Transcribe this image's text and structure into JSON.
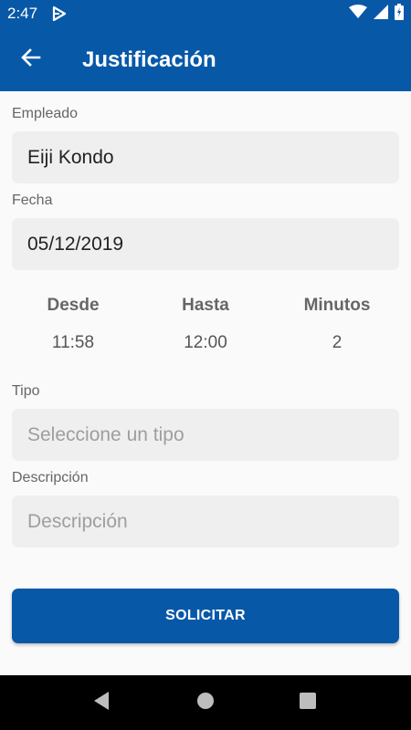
{
  "status_bar": {
    "time": "2:47",
    "icons": [
      "notification-icon",
      "wifi-icon",
      "signal-icon",
      "battery-icon"
    ]
  },
  "app_bar": {
    "title": "Justificación",
    "back_icon": "arrow-back-icon"
  },
  "form": {
    "empleado_label": "Empleado",
    "empleado_value": "Eiji Kondo",
    "fecha_label": "Fecha",
    "fecha_value": "05/12/2019",
    "times": {
      "desde_label": "Desde",
      "desde_value": "11:58",
      "hasta_label": "Hasta",
      "hasta_value": "12:00",
      "minutos_label": "Minutos",
      "minutos_value": "2"
    },
    "tipo_label": "Tipo",
    "tipo_placeholder": "Seleccione un tipo",
    "descripcion_label": "Descripción",
    "descripcion_placeholder": "Descripción",
    "submit_label": "SOLICITAR"
  },
  "nav_bar": {
    "icons": [
      "back-triangle-icon",
      "home-circle-icon",
      "recents-square-icon"
    ]
  },
  "colors": {
    "primary": "#0858a8",
    "background": "#fafafa",
    "field_bg": "#efefef"
  }
}
